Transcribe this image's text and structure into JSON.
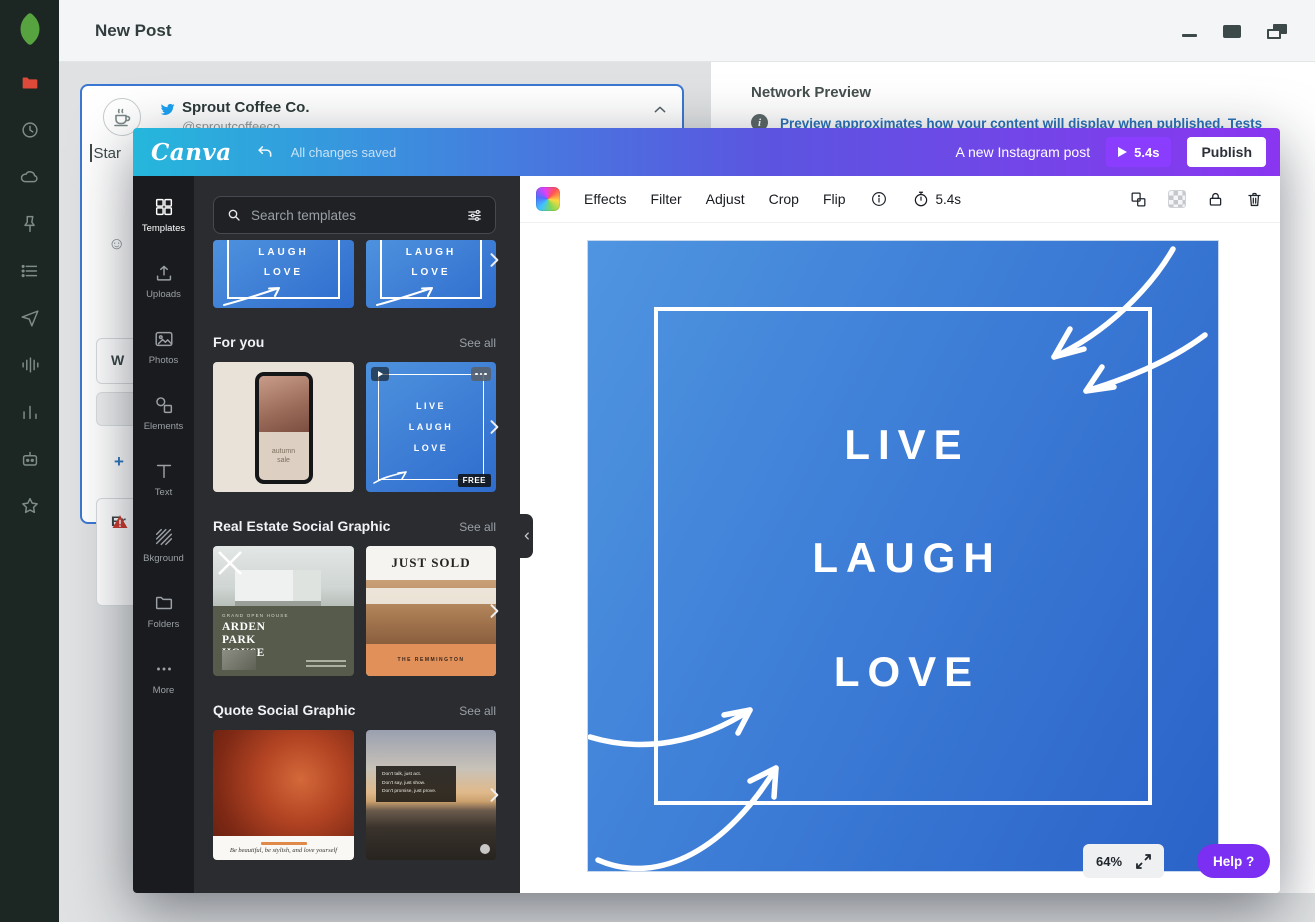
{
  "sprout": {
    "title": "New Post",
    "compose": {
      "name": "Sprout Coffee Co.",
      "handle": "@sproutcoffeeco",
      "draft": "Star"
    },
    "fragments": {
      "w": "W",
      "plus": "+",
      "er": "Er"
    },
    "preview": {
      "title": "Network Preview",
      "info": "i",
      "description": "Preview approximates how your content will display when published. Tests and"
    }
  },
  "canva": {
    "logo": "Canva",
    "status": "All changes saved",
    "post_label": "A new Instagram post",
    "play_duration": "5.4s",
    "publish": "Publish",
    "rail": [
      {
        "label": "Templates"
      },
      {
        "label": "Uploads"
      },
      {
        "label": "Photos"
      },
      {
        "label": "Elements"
      },
      {
        "label": "Text"
      },
      {
        "label": "Bkground"
      },
      {
        "label": "Folders"
      },
      {
        "label": "More"
      }
    ],
    "search_placeholder": "Search templates",
    "sections": [
      {
        "title": "For you",
        "action": "See all"
      },
      {
        "title": "Real Estate Social Graphic",
        "action": "See all"
      },
      {
        "title": "Quote Social Graphic",
        "action": "See all"
      }
    ],
    "templates": {
      "partial": {
        "l1": "LAUGH",
        "l2": "LOVE"
      },
      "autumn": {
        "line1": "autumn",
        "line2": "sale"
      },
      "lll": {
        "l1": "LIVE",
        "l2": "LAUGH",
        "l3": "LOVE",
        "badge": "FREE"
      },
      "arden": {
        "kicker": "GRAND OPEN HOUSE",
        "t1": "ARDEN",
        "t2": "PARK",
        "t3": "HOUSE"
      },
      "sold": {
        "title": "JUST SOLD",
        "footer": "THE REMMINGTON"
      },
      "hair": {
        "caption": "Be beautiful, be stylish, and love yourself"
      },
      "road": {
        "l1": "Don't talk, just act.",
        "l2": "Don't say, just show.",
        "l3": "Don't promise, just prove."
      }
    },
    "toolbar": {
      "items": [
        "Effects",
        "Filter",
        "Adjust",
        "Crop",
        "Flip"
      ],
      "duration": "5.4s"
    },
    "canvas": {
      "l1": "LIVE",
      "l2": "LAUGH",
      "l3": "LOVE"
    },
    "zoom": "64%",
    "help": "Help ?"
  },
  "colors": {
    "canva_purple": "#8b3dff",
    "canva_gradient_start": "#25b7dc",
    "canva_gradient_end": "#8a36f0",
    "twitter_blue": "#1da1f2",
    "sprout_green": "#56a33f",
    "canvas_blue_start": "#4f95e0",
    "canvas_blue_end": "#2b63c8",
    "link_blue": "#2b72b8",
    "alert_red": "#cf3a2e"
  }
}
